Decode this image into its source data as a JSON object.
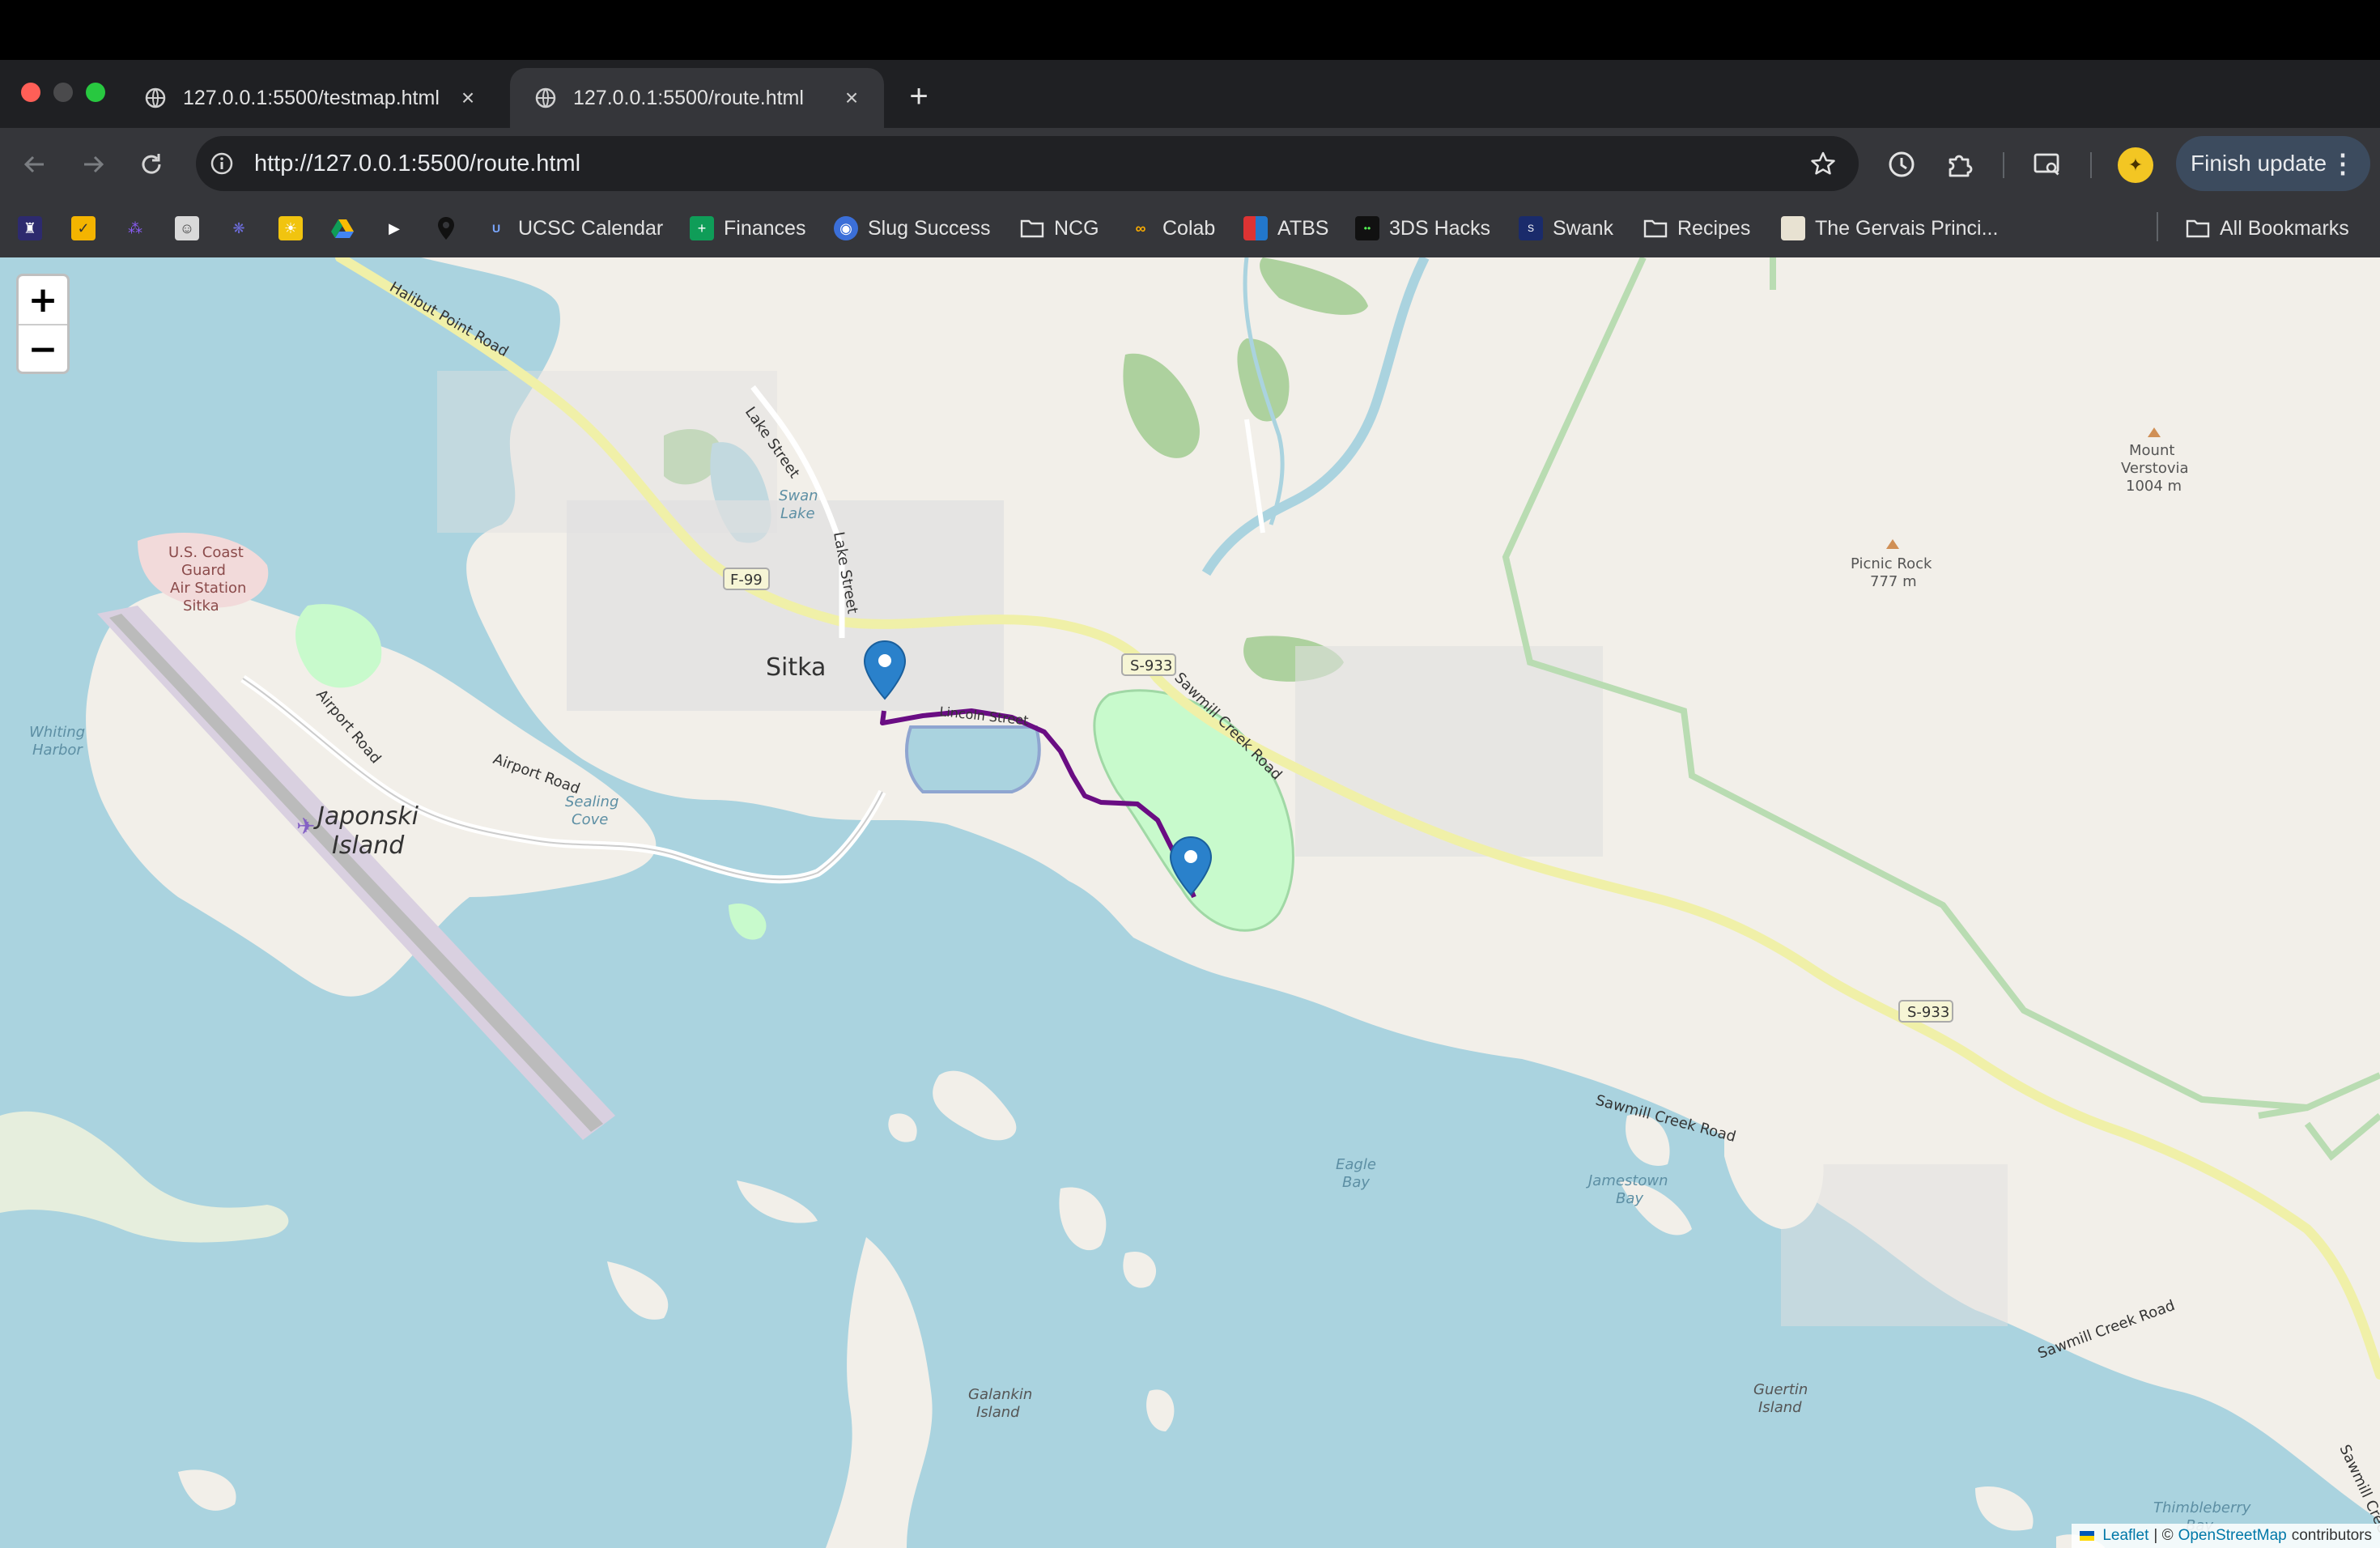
{
  "browser": {
    "tabs": [
      {
        "title": "127.0.0.1:5500/testmap.html",
        "active": false
      },
      {
        "title": "127.0.0.1:5500/route.html",
        "active": true
      }
    ],
    "new_tab_label": "+",
    "close_glyph": "×",
    "url": "http://127.0.0.1:5500/route.html",
    "finish_update_label": "Finish update",
    "menu_glyph": "⋮",
    "icons": {
      "back": "back-arrow-icon",
      "forward": "forward-arrow-icon",
      "reload": "reload-icon",
      "site_info": "site-info-icon",
      "bookmark_star": "star-icon",
      "history": "history-clock-icon",
      "extensions": "puzzle-piece-icon",
      "cast": "cast-search-icon"
    }
  },
  "bookmarks": {
    "items": [
      {
        "label": "UCSC Calendar",
        "icon": "ucsc-icon"
      },
      {
        "label": "Finances",
        "icon": "spreadsheet-icon"
      },
      {
        "label": "Slug Success",
        "icon": "slug-success-icon"
      },
      {
        "label": "NCG",
        "icon": "folder-icon"
      },
      {
        "label": "Colab",
        "icon": "colab-icon"
      },
      {
        "label": "ATBS",
        "icon": "atbs-icon"
      },
      {
        "label": "3DS Hacks",
        "icon": "3ds-hacks-icon"
      },
      {
        "label": "Swank",
        "icon": "swank-icon"
      },
      {
        "label": "Recipes",
        "icon": "folder-icon"
      },
      {
        "label": "The Gervais Princi...",
        "icon": "page-thumbnail-icon"
      }
    ],
    "all_bookmarks_label": "All Bookmarks"
  },
  "map": {
    "zoom_in_label": "+",
    "zoom_out_label": "−",
    "route_color": "#6a0d83",
    "marker_color": "#2a81cb",
    "labels": {
      "sitka": "Sitka",
      "japonski": "Japonski",
      "island": "Island",
      "halibut_point_road": "Halibut Point Road",
      "lake_street_1": "Lake Street",
      "lake_street_2": "Lake Street",
      "swan_lake_1": "Swan",
      "swan_lake_2": "Lake",
      "coast_guard_1": "U.S. Coast",
      "coast_guard_2": "Guard",
      "coast_guard_3": "Air Station",
      "coast_guard_4": "Sitka",
      "whiting_1": "Whiting",
      "whiting_2": "Harbor",
      "airport_road_1": "Airport Road",
      "airport_road_2": "Airport Road",
      "sealing_1": "Sealing",
      "sealing_2": "Cove",
      "lincoln_street": "Lincoln Street",
      "sawmill_creek_1": "Sawmill Creek Road",
      "sawmill_creek_2": "Sawmill Creek Road",
      "sawmill_creek_3": "Sawmill Creek Road",
      "sawmill_creek_4": "Sawmill Creek",
      "eagle_bay_1": "Eagle",
      "eagle_bay_2": "Bay",
      "jamestown_1": "Jamestown",
      "jamestown_2": "Bay",
      "guertin_1": "Guertin",
      "guertin_2": "Island",
      "thimbleberry_1": "Thimbleberry",
      "thimbleberry_2": "Bay",
      "galankin_1": "Galankin",
      "galankin_2": "Island",
      "mount_verstovia_1": "Mount",
      "mount_verstovia_2": "Verstovia",
      "mount_verstovia_3": "1004 m",
      "picnic_rock_1": "Picnic Rock",
      "picnic_rock_2": "777 m"
    },
    "shields": {
      "f99": "F-99",
      "s933_a": "S-933",
      "s933_b": "S-933"
    },
    "attribution": {
      "leaflet": "Leaflet",
      "separator": "| ©",
      "osm": "OpenStreetMap",
      "contributors": "contributors"
    }
  }
}
